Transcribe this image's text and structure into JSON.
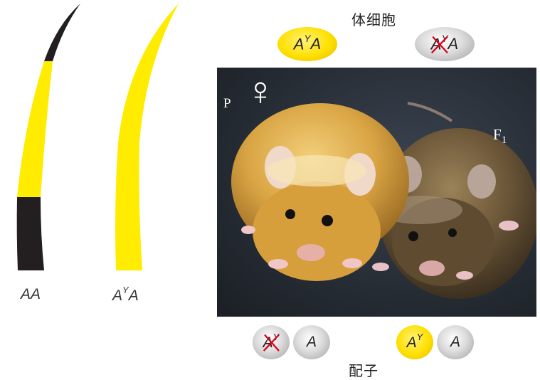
{
  "hair_labels": {
    "left": "AA",
    "right_base": "A",
    "right_sup": "Y",
    "right_tail": "A"
  },
  "body_cells": {
    "title": "体细胞",
    "cells": [
      {
        "base": "A",
        "sup": "Y",
        "tail": "A",
        "color": "yellow",
        "struck": false
      },
      {
        "base": "A",
        "sup": "Y",
        "tail": "A",
        "color": "grey",
        "struck": true
      }
    ]
  },
  "gametes": {
    "title": "配子",
    "left_group": [
      {
        "base": "A",
        "sup": "Y",
        "color": "grey",
        "struck": true
      },
      {
        "base": "A",
        "sup": "",
        "color": "grey",
        "struck": false
      }
    ],
    "right_group": [
      {
        "base": "A",
        "sup": "Y",
        "color": "yellow",
        "struck": false
      },
      {
        "base": "A",
        "sup": "",
        "color": "grey",
        "struck": false
      }
    ]
  },
  "photo": {
    "parent_label": "P",
    "female_symbol": "♀",
    "offspring_label": "F",
    "offspring_sub": "1"
  },
  "colors": {
    "hair_yellow": "#ffec00",
    "hair_black": "#231f20",
    "strike_red": "#d8001c",
    "yellow_mouse": "#d9a544",
    "brown_mouse": "#6b5638"
  }
}
